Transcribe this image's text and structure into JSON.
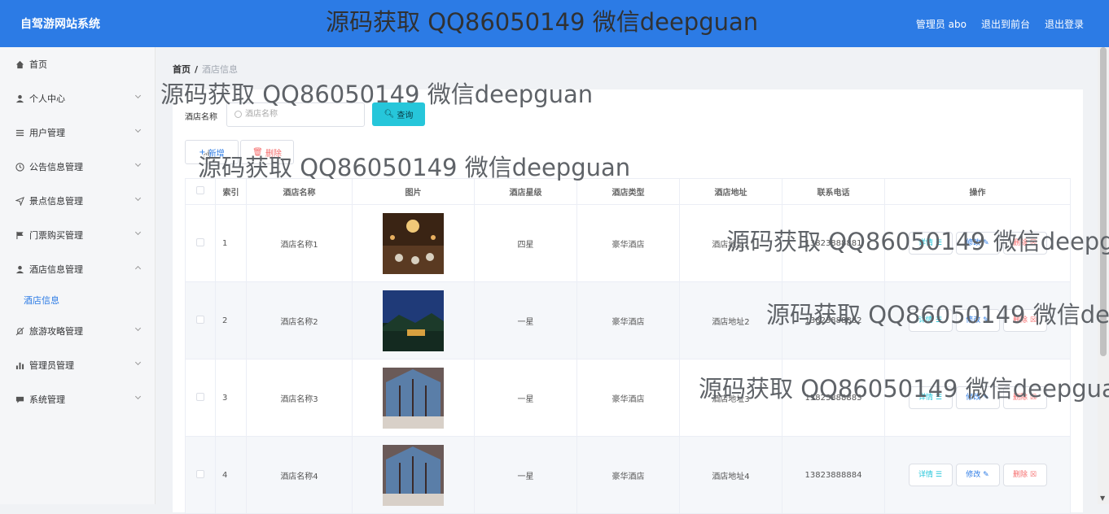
{
  "header": {
    "site_title": "自驾游网站系统",
    "banner": "源码获取 QQ86050149 微信deepguan",
    "admin_label": "管理员 abo",
    "to_frontend": "退出到前台",
    "logout": "退出登录"
  },
  "sidebar": {
    "items": [
      {
        "label": "首页",
        "icon": "home-icon"
      },
      {
        "label": "个人中心",
        "icon": "user-icon"
      },
      {
        "label": "用户管理",
        "icon": "list-icon"
      },
      {
        "label": "公告信息管理",
        "icon": "clock-icon"
      },
      {
        "label": "景点信息管理",
        "icon": "send-icon"
      },
      {
        "label": "门票购买管理",
        "icon": "flag-icon"
      },
      {
        "label": "酒店信息管理",
        "icon": "user-icon"
      },
      {
        "label": "旅游攻略管理",
        "icon": "bell-off-icon"
      },
      {
        "label": "管理员管理",
        "icon": "bar-chart-icon"
      },
      {
        "label": "系统管理",
        "icon": "chat-icon"
      }
    ],
    "sub_item": "酒店信息"
  },
  "breadcrumb": {
    "home": "首页",
    "sep": "/",
    "current": "酒店信息"
  },
  "watermark": "源码获取 QQ86050149 微信deepguan",
  "search": {
    "label": "酒店名称",
    "placeholder": "酒店名称",
    "button": "查询"
  },
  "actions": {
    "add": "新增",
    "delete": "删除"
  },
  "table": {
    "headers": [
      "",
      "索引",
      "酒店名称",
      "图片",
      "酒店星级",
      "酒店类型",
      "酒店地址",
      "联系电话",
      "操作"
    ],
    "ops": {
      "detail": "详情",
      "edit": "修改",
      "remove": "删除"
    },
    "rows": [
      {
        "index": "1",
        "name": "酒店名称1",
        "star": "四星",
        "type": "豪华酒店",
        "address": "酒店地址1",
        "phone": "13823888881"
      },
      {
        "index": "2",
        "name": "酒店名称2",
        "star": "一星",
        "type": "豪华酒店",
        "address": "酒店地址2",
        "phone": "13823888882"
      },
      {
        "index": "3",
        "name": "酒店名称3",
        "star": "一星",
        "type": "豪华酒店",
        "address": "酒店地址3",
        "phone": "13823888883"
      },
      {
        "index": "4",
        "name": "酒店名称4",
        "star": "一星",
        "type": "豪华酒店",
        "address": "酒店地址4",
        "phone": "13823888884"
      }
    ]
  },
  "colors": {
    "primary": "#2c7be5",
    "cyan": "#26c6da",
    "danger": "#f56c6c"
  }
}
